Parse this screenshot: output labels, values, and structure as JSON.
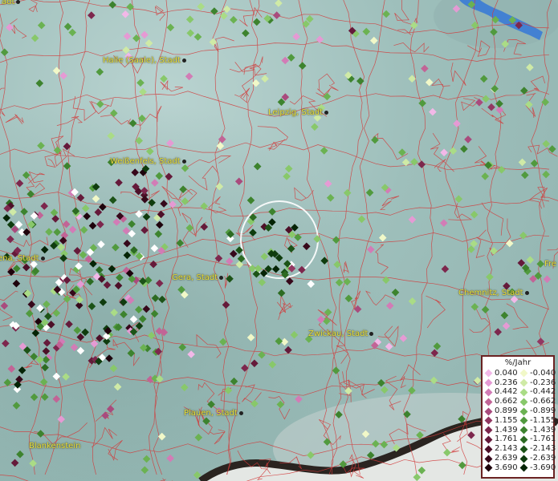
{
  "map": {
    "cities": [
      {
        "name": "Halle (Saale), Stadt"
      },
      {
        "name": "Leipzig, Stadt"
      },
      {
        "name": "Weißenfels, Stadt"
      },
      {
        "name": "Jena, Stadt"
      },
      {
        "name": "Gera, Stadt"
      },
      {
        "name": "Chemnitz, Stadt"
      },
      {
        "name": "Zwickau, Stadt"
      },
      {
        "name": "Plauen, Stadt"
      },
      {
        "name": "Blankenstein"
      },
      {
        "name": "Fre"
      },
      {
        "name": "adt"
      }
    ],
    "selection_circle_label": "selected-area",
    "colors": {
      "boundary": "#d23a3a",
      "water": "#3a7bd5",
      "selection": "#ffffff"
    }
  },
  "legend": {
    "title": "%/Jahr",
    "positive": [
      {
        "value": "0.040",
        "color": "#f2b8e8"
      },
      {
        "value": "0.236",
        "color": "#e59ad4"
      },
      {
        "value": "0.442",
        "color": "#d27cb6"
      },
      {
        "value": "0.662",
        "color": "#c26496"
      },
      {
        "value": "0.899",
        "color": "#a94b7d"
      },
      {
        "value": "1.155",
        "color": "#933862"
      },
      {
        "value": "1.439",
        "color": "#7d274d"
      },
      {
        "value": "1.761",
        "color": "#651a3a"
      },
      {
        "value": "2.143",
        "color": "#4d1028"
      },
      {
        "value": "2.639",
        "color": "#36081a"
      },
      {
        "value": "3.690",
        "color": "#1e030c"
      }
    ],
    "negative": [
      {
        "value": "-0.040",
        "color": "#f1f8c8"
      },
      {
        "value": "-0.236",
        "color": "#cfeaa6"
      },
      {
        "value": "-0.442",
        "color": "#aadc86"
      },
      {
        "value": "-0.662",
        "color": "#88c86a"
      },
      {
        "value": "-0.899",
        "color": "#6bb252"
      },
      {
        "value": "-1.155",
        "color": "#519a3e"
      },
      {
        "value": "-1.439",
        "color": "#3d832e"
      },
      {
        "value": "-1.761",
        "color": "#2c6b22"
      },
      {
        "value": "-2.143",
        "color": "#1c5317"
      },
      {
        "value": "-2.639",
        "color": "#0f3c0e"
      },
      {
        "value": "-3.690",
        "color": "#052406"
      }
    ]
  }
}
